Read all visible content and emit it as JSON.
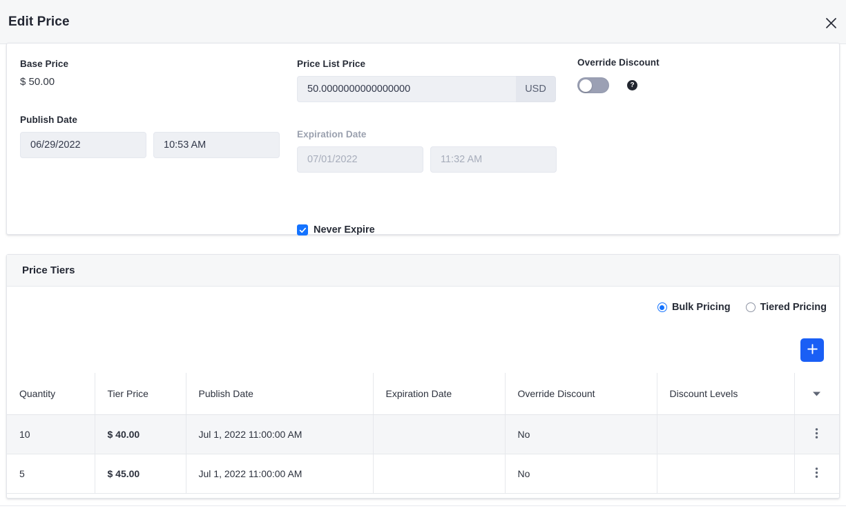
{
  "modal": {
    "title": "Edit Price",
    "close_icon": "close-icon"
  },
  "details": {
    "base_price": {
      "label": "Base Price",
      "value": "$ 50.00"
    },
    "price_list_price": {
      "label": "Price List Price",
      "value": "50.0000000000000000",
      "currency": "USD"
    },
    "override_discount": {
      "label": "Override Discount",
      "state": "off",
      "help_icon": "question-mark-icon",
      "help_glyph": "?"
    },
    "publish_date": {
      "label": "Publish Date",
      "date": "06/29/2022",
      "time": "10:53 AM"
    },
    "expiration_date": {
      "label": "Expiration Date",
      "date": "07/01/2022",
      "time": "11:32 AM",
      "disabled": true
    },
    "never_expire": {
      "label": "Never Expire",
      "checked": true
    }
  },
  "tiers": {
    "section_title": "Price Tiers",
    "pricing_mode": {
      "selected": "Bulk Pricing",
      "options": [
        {
          "label": "Bulk Pricing",
          "selected": true
        },
        {
          "label": "Tiered Pricing",
          "selected": false
        }
      ]
    },
    "add_button": {
      "name": "add-tier-button",
      "icon": "plus-icon"
    },
    "columns": [
      "Quantity",
      "Tier Price",
      "Publish Date",
      "Expiration Date",
      "Override Discount",
      "Discount Levels",
      ""
    ],
    "sort_icon": "caret-down-icon",
    "rows": [
      {
        "quantity": "10",
        "tier_price": "$ 40.00",
        "publish_date": "Jul 1, 2022 11:00:00 AM",
        "expiration_date": "",
        "override_discount": "No",
        "discount_levels": "",
        "menu_icon": "kebab-menu-icon"
      },
      {
        "quantity": "5",
        "tier_price": "$ 45.00",
        "publish_date": "Jul 1, 2022 11:00:00 AM",
        "expiration_date": "",
        "override_discount": "No",
        "discount_levels": "",
        "menu_icon": "kebab-menu-icon"
      }
    ]
  },
  "colors": {
    "accent_blue": "#1473ff",
    "add_button_blue": "#1a5ff5",
    "header_bg": "#f6f7f8",
    "input_bg": "#eef0f4",
    "toggle_off": "#9ba0b4",
    "row_alt_bg": "#f5f6f8"
  }
}
